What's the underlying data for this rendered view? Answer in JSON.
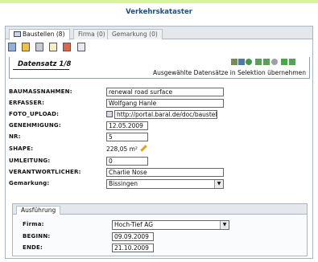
{
  "app_title": "Verkehrskataster",
  "tabs": [
    {
      "label": "Baustellen (8)"
    },
    {
      "label": "Firma (0)"
    },
    {
      "label": "Gemarkung (0)"
    }
  ],
  "toolbar_icons": [
    "list-icon",
    "new-document-icon",
    "print-icon",
    "export-icon",
    "delete-icon",
    "next-page-icon"
  ],
  "record": {
    "title": "Datensatz 1/8",
    "selection_note": "Ausgewählte Datensätze in Selektion übernehmen",
    "nav_icons": [
      "save-icon",
      "grid-icon",
      "globe-icon",
      "first-record-icon",
      "previous-record-icon",
      "search-icon",
      "add-record-icon",
      "last-record-icon"
    ]
  },
  "fields": {
    "baumassnahmen": {
      "label": "BAUMASSNAHMEN:",
      "value": "renewal road surface"
    },
    "erfasser": {
      "label": "ERFASSER:",
      "value": "Wolfgang Hanle"
    },
    "foto_upload": {
      "label": "FOTO_UPLOAD:",
      "value": "http://portal.baral.de/doc/baustelle"
    },
    "genehmigung": {
      "label": "GENEHMIGUNG:",
      "value": "12.05.2009"
    },
    "nr": {
      "label": "NR:",
      "value": "5"
    },
    "shape": {
      "label": "SHAPE:",
      "value": "228,05 m²"
    },
    "umleitung": {
      "label": "UMLEITUNG:",
      "value": "0"
    },
    "verantwortlicher": {
      "label": "VERANTWORTLICHER:",
      "value": "Charlie Nose"
    },
    "gemarkung": {
      "label": "Gemarkung:",
      "value": "Bissingen"
    }
  },
  "ausfuehrung": {
    "tab_label": "Ausführung",
    "firma": {
      "label": "Firma:",
      "value": "Hoch-Tief AG"
    },
    "beginn": {
      "label": "BEGINN:",
      "value": "09.09.2009"
    },
    "ende": {
      "label": "ENDE:",
      "value": "21.10.2009"
    }
  },
  "colors": {
    "accent_bar": "#d9f59a",
    "title_blue": "#1d4f7a",
    "border": "#a9b6c2"
  }
}
